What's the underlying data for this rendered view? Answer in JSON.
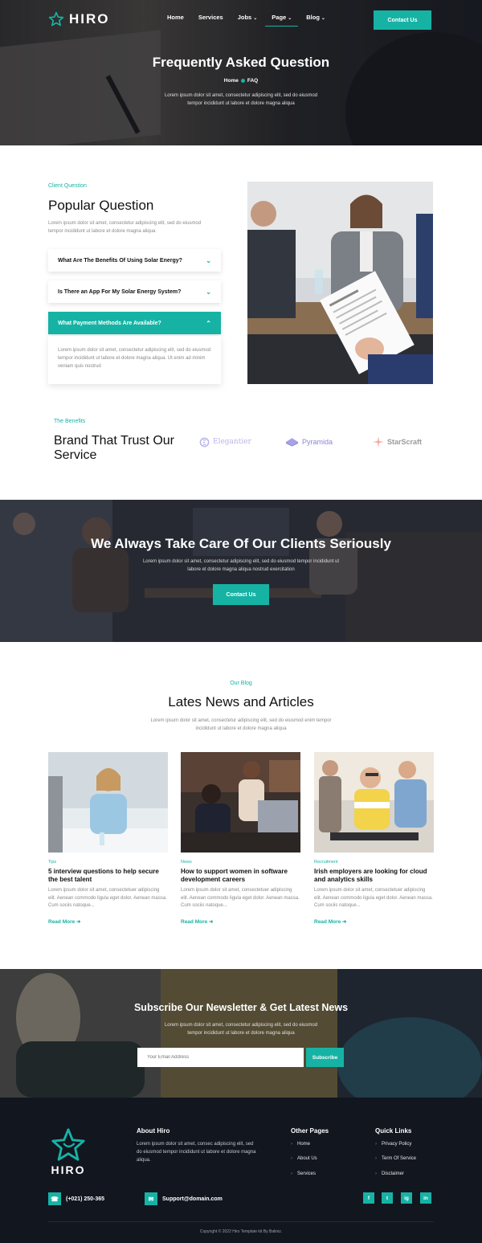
{
  "brand": {
    "name": "HIRO",
    "accent": "#16b3a5"
  },
  "nav": {
    "items": [
      {
        "label": "Home"
      },
      {
        "label": "Services"
      },
      {
        "label": "Jobs"
      },
      {
        "label": "Page"
      },
      {
        "label": "Blog"
      }
    ],
    "active": "Page",
    "cta_label": "Contact Us"
  },
  "hero": {
    "title": "Frequently Asked Question",
    "breadcrumb": {
      "home": "Home",
      "current": "FAQ"
    },
    "description": "Lorem ipsum dolor sit amet, consectetur adipiscing elit, sed do eiusmod tempor incididunt ut labore et dolore magna aliqua"
  },
  "faq": {
    "kicker": "Client Question",
    "title": "Popular Question",
    "description": "Lorem ipsum dolor sit amet, consectetur adipiscing elit, sed do eiusmod tempor incididunt ut labore et dolore magna aliqua",
    "items": [
      {
        "question": "What Are The Benefits Of Using Solar Energy?"
      },
      {
        "question": "Is There an App For My Solar Energy System?"
      },
      {
        "question": "What Payment Methods Are Available?"
      }
    ],
    "open_answer": "Lorem ipsum dolor sit amet, consectetur adipiscing elit, sed do eiusmod tempor incididunt ut labore et dolore magna aliqua. Ut enim ad minim veniam quis nostrud"
  },
  "benefits": {
    "kicker": "The Benefits",
    "title": "Brand That Trust Our Service",
    "brands": [
      "Elegantier",
      "Pyramida",
      "StarScraft"
    ]
  },
  "cta": {
    "title": "We Always Take Care Of Our Clients Seriously",
    "description": "Lorem ipsum dolor sit amet, consectetur adipiscing elit, sed do eiusmod tempor incididunt ut labore et dolore magna aliqua nostrud exercitation",
    "button": "Contact Us"
  },
  "blog": {
    "kicker": "Our Blog",
    "title": "Lates News and Articles",
    "description": "Lorem ipsum dolor sit amet, consectetur adipiscing elit, sed do eiusmod enim tempor incididunt ut labore et dolore magna aliqua",
    "posts": [
      {
        "tag": "Tips",
        "title": "5 interview questions to help secure the best talent",
        "excerpt": "Lorem ipsum dolor sit amet, consectetuer adipiscing elit. Aenean commodo ligula eget dolor. Aenean massa. Cum sociis natoque...",
        "more": "Read More"
      },
      {
        "tag": "News",
        "title": "How to support women in software development careers",
        "excerpt": "Lorem ipsum dolor sit amet, consectetuer adipiscing elit. Aenean commodo ligula eget dolor. Aenean massa. Cum sociis natoque...",
        "more": "Read More"
      },
      {
        "tag": "Recruitment",
        "title": "Irish employers are looking for cloud and analytics skills",
        "excerpt": "Lorem ipsum dolor sit amet, consectetuer adipiscing elit. Aenean commodo ligula eget dolor. Aenean massa. Cum sociis natoque...",
        "more": "Read More"
      }
    ]
  },
  "newsletter": {
    "title": "Subscribe Our Newsletter & Get Latest News",
    "description": "Lorem ipsum dolor sit amet, consectetur adipiscing elit, sed do eiusmod tempor incididunt ut labore et dolore magna aliqua",
    "placeholder": "Your Email Address",
    "button": "Subscribe"
  },
  "footer": {
    "logo": "HIRO",
    "about_title": "About Hiro",
    "about_text": "Lorem ipsum dolor sit amet, consec adipiscing elit, sed do eiusmod tempor incididunt ut labore et dolore magna aliqua.",
    "other_title": "Other Pages",
    "other_links": [
      "Home",
      "About Us",
      "Services"
    ],
    "quick_title": "Quick Links",
    "quick_links": [
      "Privacy Policy",
      "Term Of Service",
      "Disclaimer"
    ],
    "phone": "(+021) 250-365",
    "email": "Support@domain.com",
    "social": [
      "f",
      "t",
      "ig",
      "in"
    ],
    "copyright": "Copyright © 2022 Hiro Template kit By Baliniz."
  }
}
